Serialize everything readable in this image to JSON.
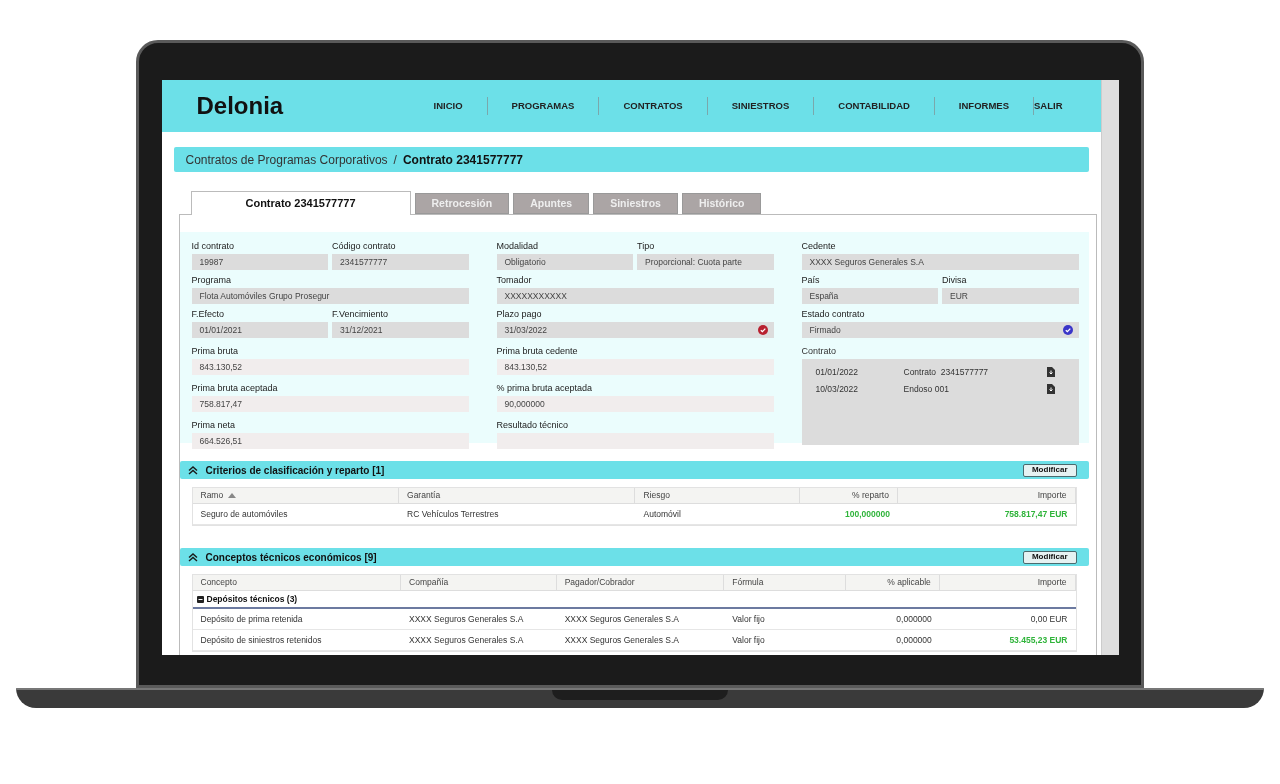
{
  "brand": "Delonia",
  "nav": [
    {
      "label": "INICIO"
    },
    {
      "label": "PROGRAMAS"
    },
    {
      "label": "CONTRATOS"
    },
    {
      "label": "SINIESTROS"
    },
    {
      "label": "CONTABILIDAD"
    },
    {
      "label": "INFORMES"
    }
  ],
  "logout": "SALIR",
  "breadcrumb": {
    "parent": "Contratos de Programas Corporativos",
    "separator": "/",
    "current": "Contrato 2341577777"
  },
  "tabs": [
    {
      "label": "Contrato 2341577777",
      "selected": true
    },
    {
      "label": "Retrocesión",
      "selected": false
    },
    {
      "label": "Apuntes",
      "selected": false
    },
    {
      "label": "Siniestros",
      "selected": false
    },
    {
      "label": "Histórico",
      "selected": false
    }
  ],
  "form": {
    "columns": [
      [
        [
          {
            "label": "Id contrato",
            "value": "19987",
            "editable": false
          },
          {
            "label": "Código contrato",
            "value": "2341577777",
            "editable": false
          }
        ],
        [
          {
            "label": "Programa",
            "value": "Flota Automóviles Grupo Prosegur",
            "editable": false
          }
        ],
        [
          {
            "label": "F.Efecto",
            "value": "01/01/2021",
            "editable": false
          },
          {
            "label": "F.Vencimiento",
            "value": "31/12/2021",
            "editable": false
          }
        ],
        [
          {
            "label": "Prima bruta",
            "value": "843.130,52",
            "editable": true
          }
        ],
        [
          {
            "label": "Prima bruta aceptada",
            "value": "758.817,47",
            "editable": true
          }
        ],
        [
          {
            "label": "Prima neta",
            "value": "664.526,51",
            "editable": true
          }
        ]
      ],
      [
        [
          {
            "label": "Modalidad",
            "value": "Obligatorio",
            "editable": false
          },
          {
            "label": "Tipo",
            "value": "Proporcional: Cuota parte",
            "editable": false
          }
        ],
        [
          {
            "label": "Tomador",
            "value": "XXXXXXXXXXX",
            "editable": false
          }
        ],
        [
          {
            "label": "Plazo pago",
            "value": "31/03/2022",
            "editable": false,
            "color": "#b8202f"
          }
        ],
        [
          {
            "label": "Prima bruta cedente",
            "value": "843.130,52",
            "editable": true
          }
        ],
        [
          {
            "label": "% prima bruta aceptada",
            "value": "90,000000",
            "editable": true
          }
        ],
        [
          {
            "label": "Resultado técnico",
            "editable": true
          }
        ]
      ],
      [
        [
          {
            "label": "Cedente",
            "value": "XXXX Seguros Generales S.A",
            "editable": false
          }
        ],
        [
          {
            "label": "País",
            "value": "España",
            "editable": false
          },
          {
            "label": "Divisa",
            "value": "EUR",
            "editable": false
          }
        ],
        [
          {
            "label": "Estado contrato",
            "value": "Firmado",
            "editable": false,
            "color": "#3a36c8"
          }
        ]
      ]
    ],
    "documents": {
      "label": "Contrato",
      "items": [
        {
          "date": "01/01/2022",
          "name": "Contrato  2341577777"
        },
        {
          "date": "10/03/2022",
          "name": "Endoso 001"
        }
      ]
    }
  },
  "sections": [
    {
      "title": "Criterios de clasificación y reparto [1]",
      "expanded": true,
      "button": "Modificar",
      "columns": [
        {
          "label": "Ramo",
          "kind": "text",
          "sorted": true
        },
        {
          "label": "Garantía",
          "kind": "text",
          "sorted": false
        },
        {
          "label": "Riesgo",
          "kind": "text",
          "sorted": false
        },
        {
          "label": "% reparto",
          "kind": "number",
          "sorted": false
        },
        {
          "label": "Importe",
          "kind": "number",
          "sorted": false
        }
      ],
      "groups": [
        {
          "rows": [
            [
              {
                "text": "Seguro de automóviles",
                "highlight": false
              },
              {
                "text": "RC Vehículos Terrestres",
                "highlight": false
              },
              {
                "text": "Automóvil",
                "highlight": false
              },
              {
                "text": "100,000000",
                "highlight": true
              },
              {
                "text": "758.817,47 EUR",
                "highlight": true
              }
            ]
          ]
        }
      ]
    },
    {
      "title": "Conceptos técnicos económicos [9]",
      "expanded": true,
      "button": "Modificar",
      "columns": [
        {
          "label": "Concepto",
          "kind": "text",
          "sorted": false
        },
        {
          "label": "Compañía",
          "kind": "text",
          "sorted": false
        },
        {
          "label": "Pagador/Cobrador",
          "kind": "text",
          "sorted": false
        },
        {
          "label": "Fórmula",
          "kind": "text",
          "sorted": false
        },
        {
          "label": "% aplicable",
          "kind": "number",
          "sorted": false
        },
        {
          "label": "Importe",
          "kind": "number",
          "sorted": false
        }
      ],
      "groups": [
        {
          "title": "Depósitos técnicos (3)",
          "expanded": true,
          "rows": [
            [
              {
                "text": "Depósito de prima retenida",
                "highlight": false
              },
              {
                "text": "XXXX Seguros Generales S.A",
                "highlight": false
              },
              {
                "text": "XXXX Seguros Generales S.A",
                "highlight": false
              },
              {
                "text": "Valor fijo",
                "highlight": false
              },
              {
                "text": "0,000000",
                "highlight": false
              },
              {
                "text": "0,00 EUR",
                "highlight": false
              }
            ],
            [
              {
                "text": "Depósito de siniestros retenidos",
                "highlight": false
              },
              {
                "text": "XXXX Seguros Generales S.A",
                "highlight": false
              },
              {
                "text": "XXXX Seguros Generales S.A",
                "highlight": false
              },
              {
                "text": "Valor fijo",
                "highlight": false
              },
              {
                "text": "0,000000",
                "highlight": false
              },
              {
                "text": "53.455,23 EUR",
                "highlight": true
              }
            ]
          ]
        }
      ]
    }
  ]
}
